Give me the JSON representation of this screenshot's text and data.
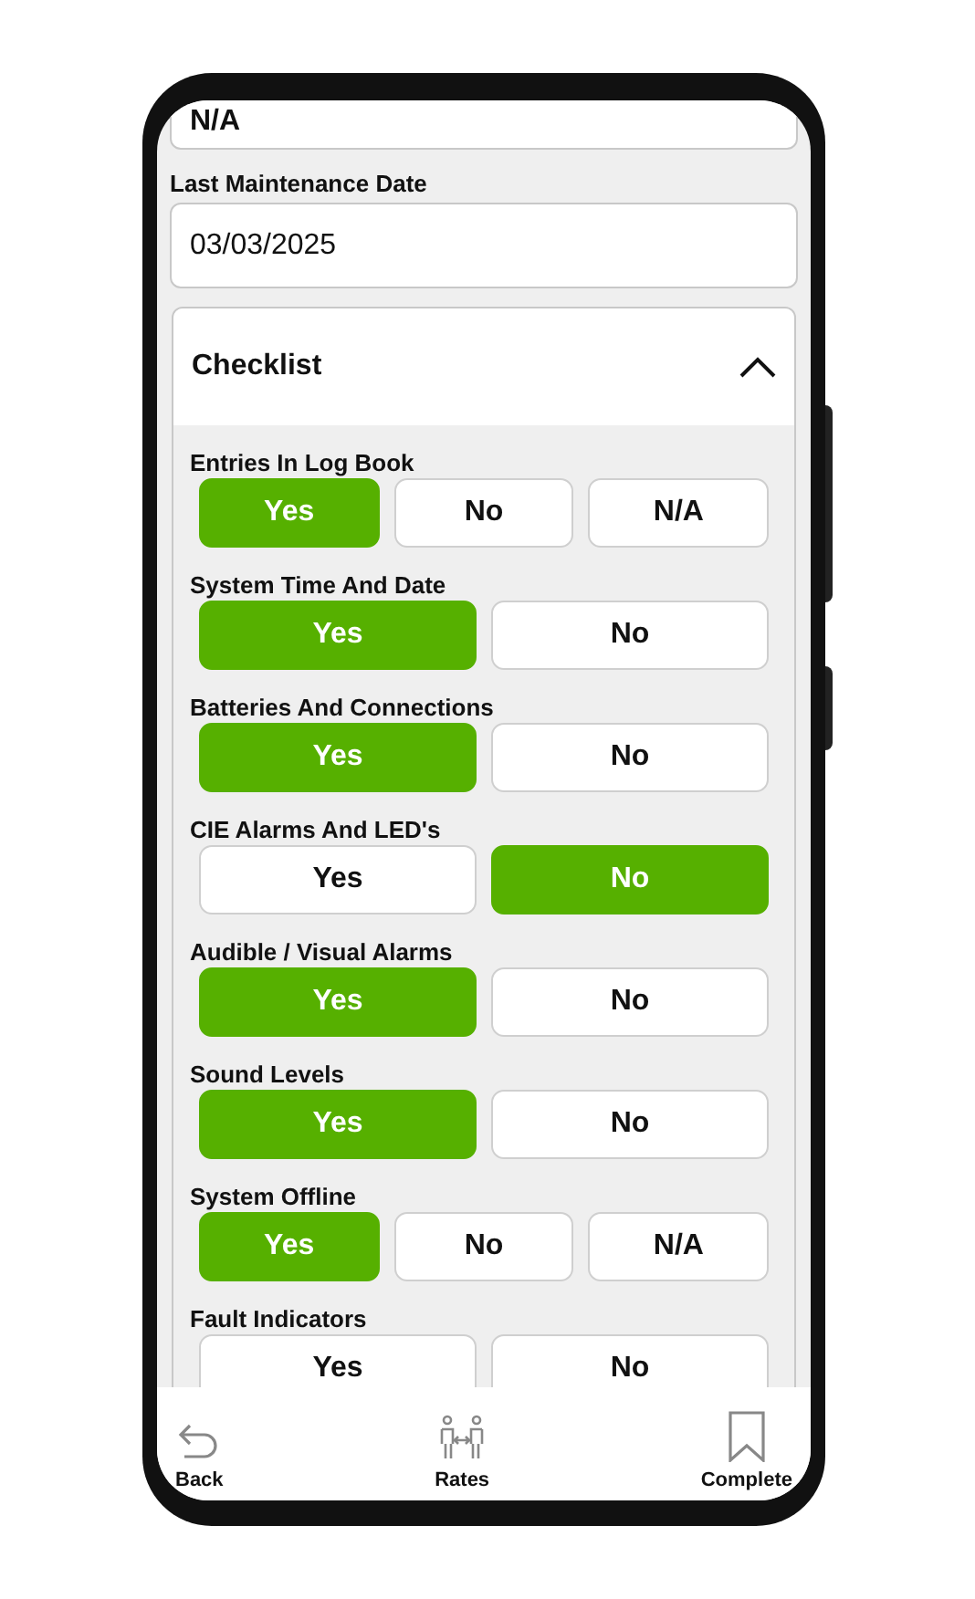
{
  "top_field": {
    "value": "N/A"
  },
  "last_maintenance": {
    "label": "Last Maintenance Date",
    "value": "03/03/2025"
  },
  "checklist": {
    "title": "Checklist",
    "expanded": true,
    "items": [
      {
        "label": "Entries In Log Book",
        "options": [
          {
            "label": "Yes",
            "selected": true
          },
          {
            "label": "No",
            "selected": false
          },
          {
            "label": "N/A",
            "selected": false
          }
        ]
      },
      {
        "label": "System Time And Date",
        "options": [
          {
            "label": "Yes",
            "selected": true
          },
          {
            "label": "No",
            "selected": false
          }
        ]
      },
      {
        "label": "Batteries And Connections",
        "options": [
          {
            "label": "Yes",
            "selected": true
          },
          {
            "label": "No",
            "selected": false
          }
        ]
      },
      {
        "label": "CIE Alarms And LED's",
        "options": [
          {
            "label": "Yes",
            "selected": false
          },
          {
            "label": "No",
            "selected": true
          }
        ]
      },
      {
        "label": "Audible / Visual Alarms",
        "options": [
          {
            "label": "Yes",
            "selected": true
          },
          {
            "label": "No",
            "selected": false
          }
        ]
      },
      {
        "label": "Sound Levels",
        "options": [
          {
            "label": "Yes",
            "selected": true
          },
          {
            "label": "No",
            "selected": false
          }
        ]
      },
      {
        "label": "System Offline",
        "options": [
          {
            "label": "Yes",
            "selected": true
          },
          {
            "label": "No",
            "selected": false
          },
          {
            "label": "N/A",
            "selected": false
          }
        ]
      },
      {
        "label": "Fault Indicators",
        "options": [
          {
            "label": "Yes",
            "selected": false
          },
          {
            "label": "No",
            "selected": false
          }
        ]
      }
    ]
  },
  "bottom_nav": [
    {
      "kind": "back",
      "label": "Back"
    },
    {
      "kind": "rates",
      "label": "Rates"
    },
    {
      "kind": "complete",
      "label": "Complete"
    }
  ]
}
